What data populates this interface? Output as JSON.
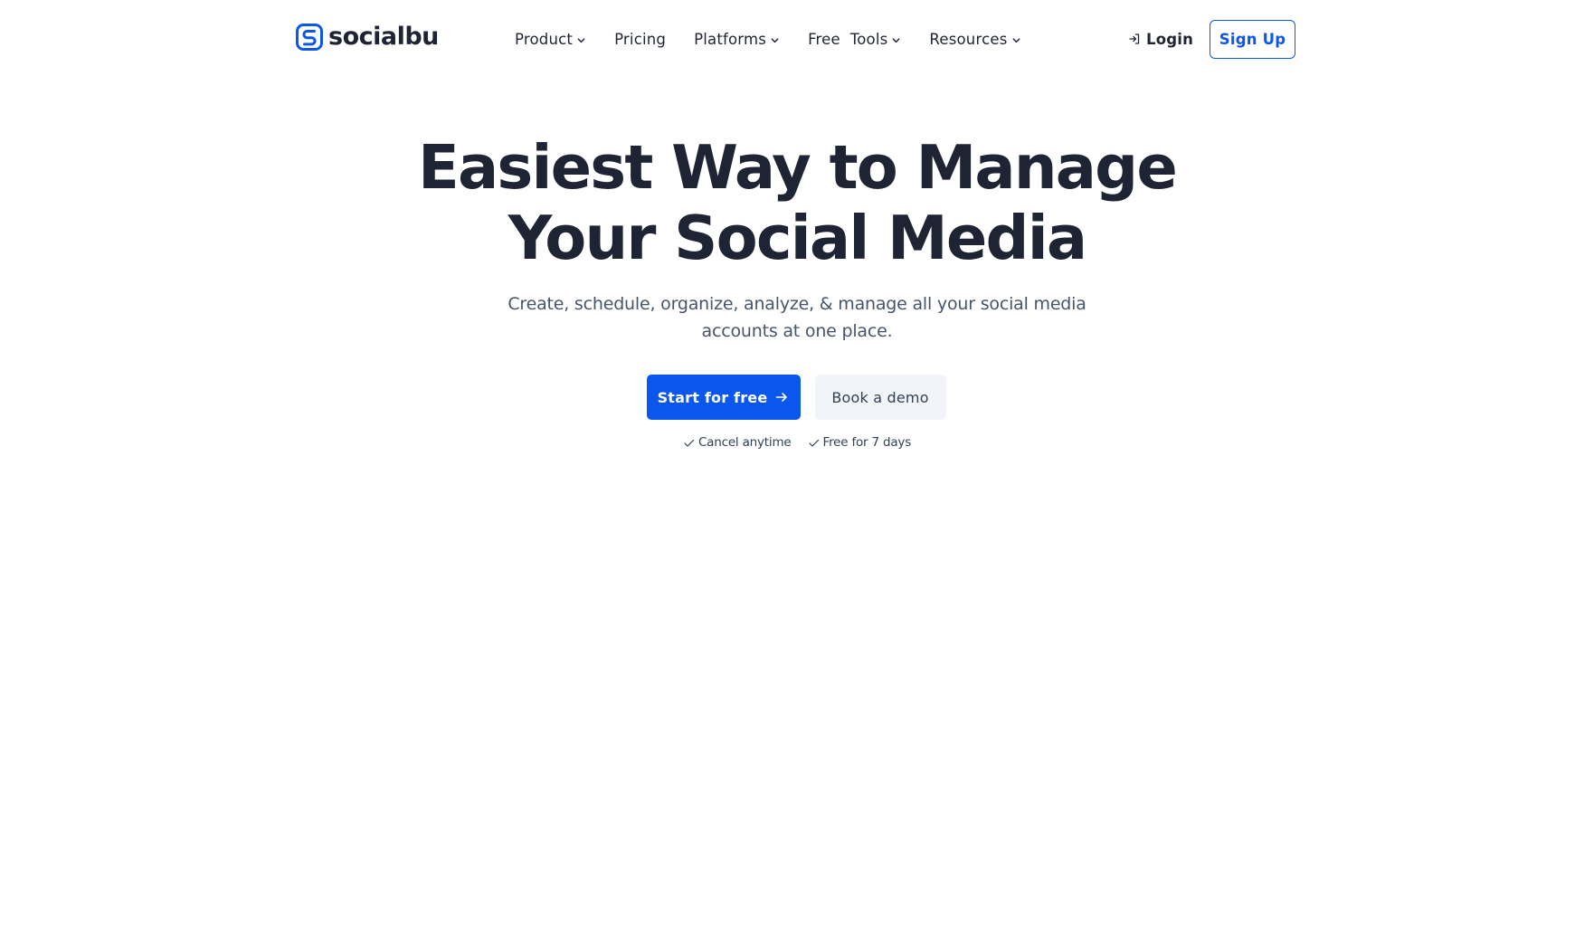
{
  "brand": {
    "name": "socialbu",
    "logo_icon": "socialbu-logo-icon",
    "color": "#0b57ee"
  },
  "nav": {
    "items": [
      {
        "label": "Product",
        "has_dropdown": true
      },
      {
        "label": "Pricing",
        "has_dropdown": false
      },
      {
        "label": "Platforms",
        "has_dropdown": true
      },
      {
        "label": "Free  Tools",
        "has_dropdown": true
      },
      {
        "label": "Resources",
        "has_dropdown": true
      }
    ],
    "login_label": "Login",
    "login_icon": "login-arrow-icon",
    "signup_label": "Sign Up"
  },
  "hero": {
    "title_line1": "Easiest Way to Manage",
    "title_line2": "Your Social Media",
    "subtitle": "Create, schedule, organize, analyze, & manage all your social media accounts at one place.",
    "primary_cta": "Start for free",
    "primary_cta_icon": "arrow-right-icon",
    "secondary_cta": "Book a demo",
    "perks": [
      {
        "label": "Cancel anytime",
        "icon": "check-icon"
      },
      {
        "label": "Free for 7 days",
        "icon": "check-icon"
      }
    ]
  },
  "colors": {
    "accent": "#0b57ee",
    "heading": "#1e2433",
    "body_text": "#475569",
    "secondary_button_bg": "#f1f5f9"
  }
}
